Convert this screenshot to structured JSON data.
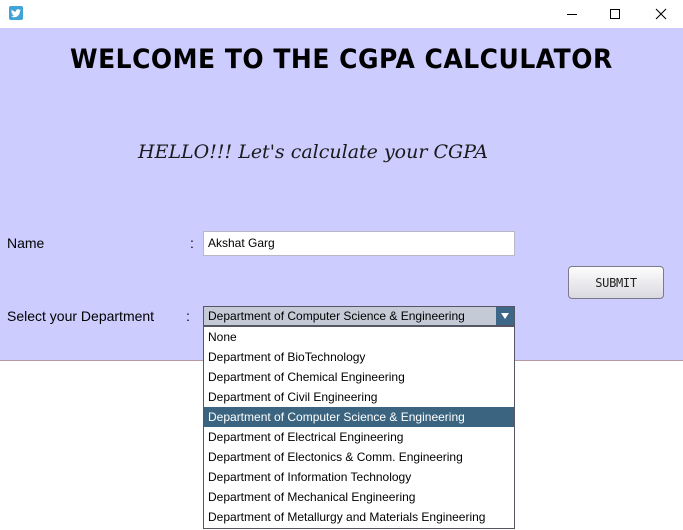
{
  "window": {
    "minimize_glyph": "—",
    "maximize_glyph": "☐",
    "close_glyph": "✕"
  },
  "header": {
    "title": "WELCOME TO THE CGPA CALCULATOR",
    "greeting": "HELLO!!! Let's calculate your CGPA"
  },
  "form": {
    "name_label": "Name",
    "name_colon": ":",
    "name_value": "Akshat Garg",
    "department_label": "Select your Department",
    "department_colon": ":",
    "department_selected": "Department of Computer Science & Engineering",
    "submit_label": "SUBMIT"
  },
  "dropdown": {
    "options": [
      "None",
      "Department of BioTechnology",
      "Department of Chemical Engineering",
      "Department of Civil Engineering",
      "Department of Computer Science & Engineering",
      "Department of Electrical Engineering",
      "Department of Electonics & Comm. Engineering",
      "Department of Information Technology",
      "Department of Mechanical Engineering",
      "Department of Metallurgy and Materials Engineering"
    ],
    "selected_index": 4
  },
  "icons": {
    "app": "app-bird-icon",
    "arrow": "chevron-down-icon"
  },
  "colors": {
    "background": "#ccccff",
    "highlight": "#3a6480",
    "combo_bg": "#c4cad6"
  }
}
